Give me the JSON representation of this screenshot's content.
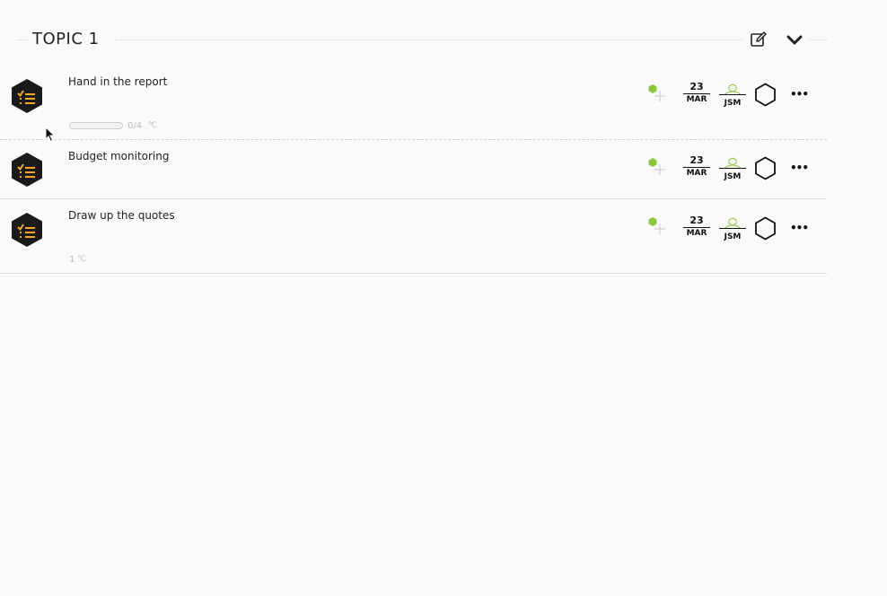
{
  "topic": {
    "title": "TOPIC 1",
    "edit_icon": "edit-icon",
    "collapse_icon": "chevron-down-icon"
  },
  "tasks": [
    {
      "title": "Hand in the report",
      "progress_text": "0/4",
      "progress": 0,
      "date_day": "23",
      "date_month": "MAR",
      "assignee": "JSM",
      "type_icon": "checklist-icon"
    },
    {
      "title": "Budget monitoring",
      "progress_text": "",
      "date_day": "23",
      "date_month": "MAR",
      "assignee": "JSM",
      "type_icon": "checklist-icon"
    },
    {
      "title": "Draw up the quotes",
      "comment_count": "1",
      "date_day": "23",
      "date_month": "MAR",
      "assignee": "JSM",
      "type_icon": "checklist-icon"
    }
  ],
  "colors": {
    "badge_bg": "#1a1a1a",
    "badge_icon": "#f5a623",
    "tag_green": "#8cc63f",
    "muted": "#bdbdbd"
  }
}
